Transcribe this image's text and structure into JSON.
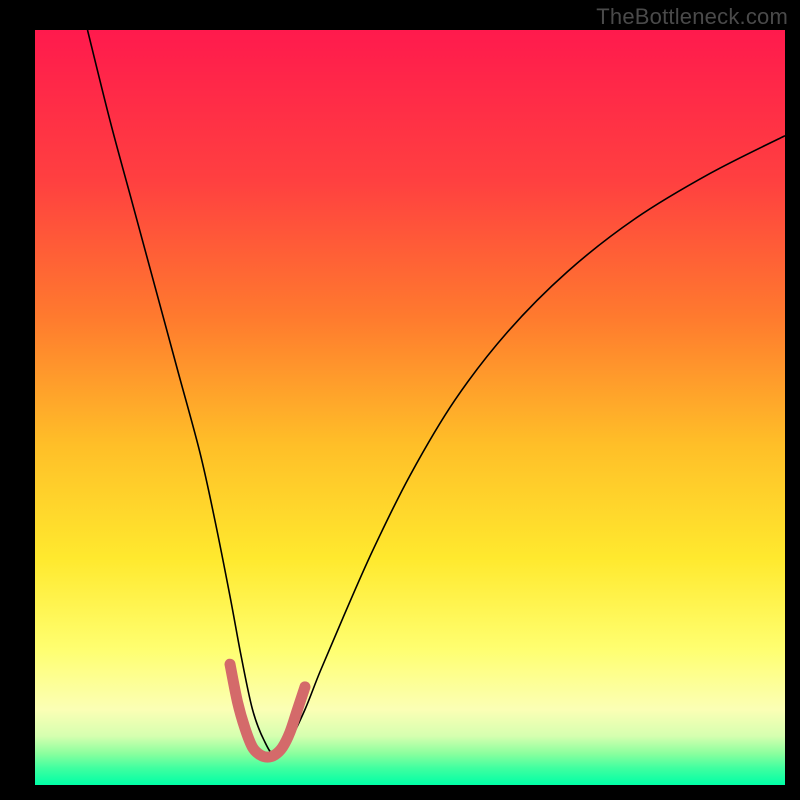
{
  "watermark": "TheBottleneck.com",
  "chart_data": {
    "type": "line",
    "title": "",
    "xlabel": "",
    "ylabel": "",
    "xlim": [
      0,
      100
    ],
    "ylim": [
      0,
      100
    ],
    "grid": false,
    "legend": false,
    "gradient_stops": [
      {
        "offset": 0.0,
        "color": "#ff1a4d"
      },
      {
        "offset": 0.2,
        "color": "#ff4040"
      },
      {
        "offset": 0.38,
        "color": "#ff7a2e"
      },
      {
        "offset": 0.55,
        "color": "#ffbf28"
      },
      {
        "offset": 0.7,
        "color": "#ffe92e"
      },
      {
        "offset": 0.82,
        "color": "#ffff70"
      },
      {
        "offset": 0.9,
        "color": "#fbffb5"
      },
      {
        "offset": 0.935,
        "color": "#d6ffb0"
      },
      {
        "offset": 0.958,
        "color": "#8cff9e"
      },
      {
        "offset": 0.978,
        "color": "#3fffa0"
      },
      {
        "offset": 1.0,
        "color": "#00ffa6"
      }
    ],
    "series": [
      {
        "name": "bottleneck-curve",
        "stroke": "#000000",
        "stroke_width": 1.6,
        "x": [
          7,
          10,
          13,
          16,
          19,
          22,
          24,
          26,
          27.5,
          29,
          30.5,
          32,
          34,
          36,
          38,
          41,
          45,
          50,
          56,
          63,
          71,
          80,
          90,
          100
        ],
        "values": [
          100,
          88,
          77,
          66,
          55,
          44,
          35,
          25,
          17,
          10,
          6,
          4,
          6,
          10,
          15,
          22,
          31,
          41,
          51,
          60,
          68,
          75,
          81,
          86
        ]
      },
      {
        "name": "bottleneck-highlight",
        "stroke": "#d46a6a",
        "stroke_width": 11,
        "linecap": "round",
        "x": [
          26,
          27,
          28,
          29,
          30,
          31,
          32,
          33,
          34,
          35,
          36
        ],
        "values": [
          16,
          11,
          7.5,
          5,
          4,
          3.7,
          4,
          5,
          7,
          10,
          13
        ]
      }
    ]
  }
}
